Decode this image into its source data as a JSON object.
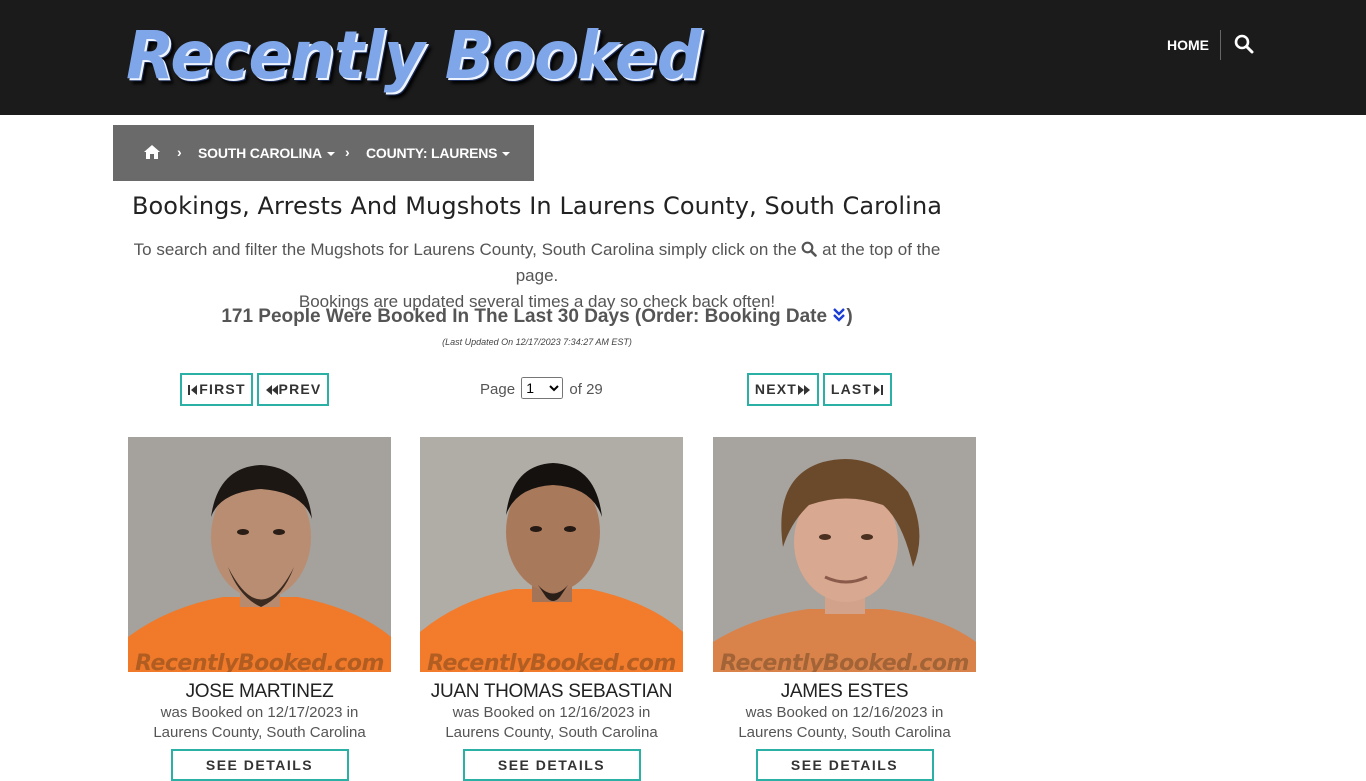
{
  "header": {
    "logo_text": "Recently Booked",
    "nav_home": "HOME",
    "search_icon": "search-icon"
  },
  "breadcrumb": {
    "home_icon": "home-icon",
    "state": "SOUTH CAROLINA",
    "county": "COUNTY: LAURENS"
  },
  "main": {
    "title": "Bookings, Arrests And Mugshots In Laurens County, South Carolina",
    "intro_part1": "To search and filter the Mugshots for Laurens County, South Carolina simply click on the",
    "intro_part2": "at the top of the page.",
    "intro_line2": "Bookings are updated several times a day so check back often!",
    "count_text": "171 People Were Booked In The Last 30 Days (Order: Booking Date",
    "count_close": ")",
    "updated": "(Last Updated On 12/17/2023 7:34:27 AM EST)"
  },
  "pagination": {
    "first": "FIRST",
    "prev": "PREV",
    "next": "NEXT",
    "last": "LAST",
    "page_label": "Page",
    "current_page": "1",
    "of_label": "of 29"
  },
  "bookings": [
    {
      "name": "JOSE MARTINEZ",
      "booked": "was Booked on 12/17/2023 in",
      "location": "Laurens County, South Carolina",
      "button": "SEE DETAILS",
      "watermark": "RecentlyBooked.com"
    },
    {
      "name": "JUAN THOMAS SEBASTIAN",
      "booked": "was Booked on 12/16/2023 in",
      "location": "Laurens County, South Carolina",
      "button": "SEE DETAILS",
      "watermark": "RecentlyBooked.com"
    },
    {
      "name": "JAMES ESTES",
      "booked": "was Booked on 12/16/2023 in",
      "location": "Laurens County, South Carolina",
      "button": "SEE DETAILS",
      "watermark": "RecentlyBooked.com"
    }
  ],
  "colors": {
    "header_bg": "#1b1b1b",
    "breadcrumb_bg": "#6a6a6a",
    "button_border": "#2ab0a5",
    "sort_icon": "#1a3dd6"
  }
}
